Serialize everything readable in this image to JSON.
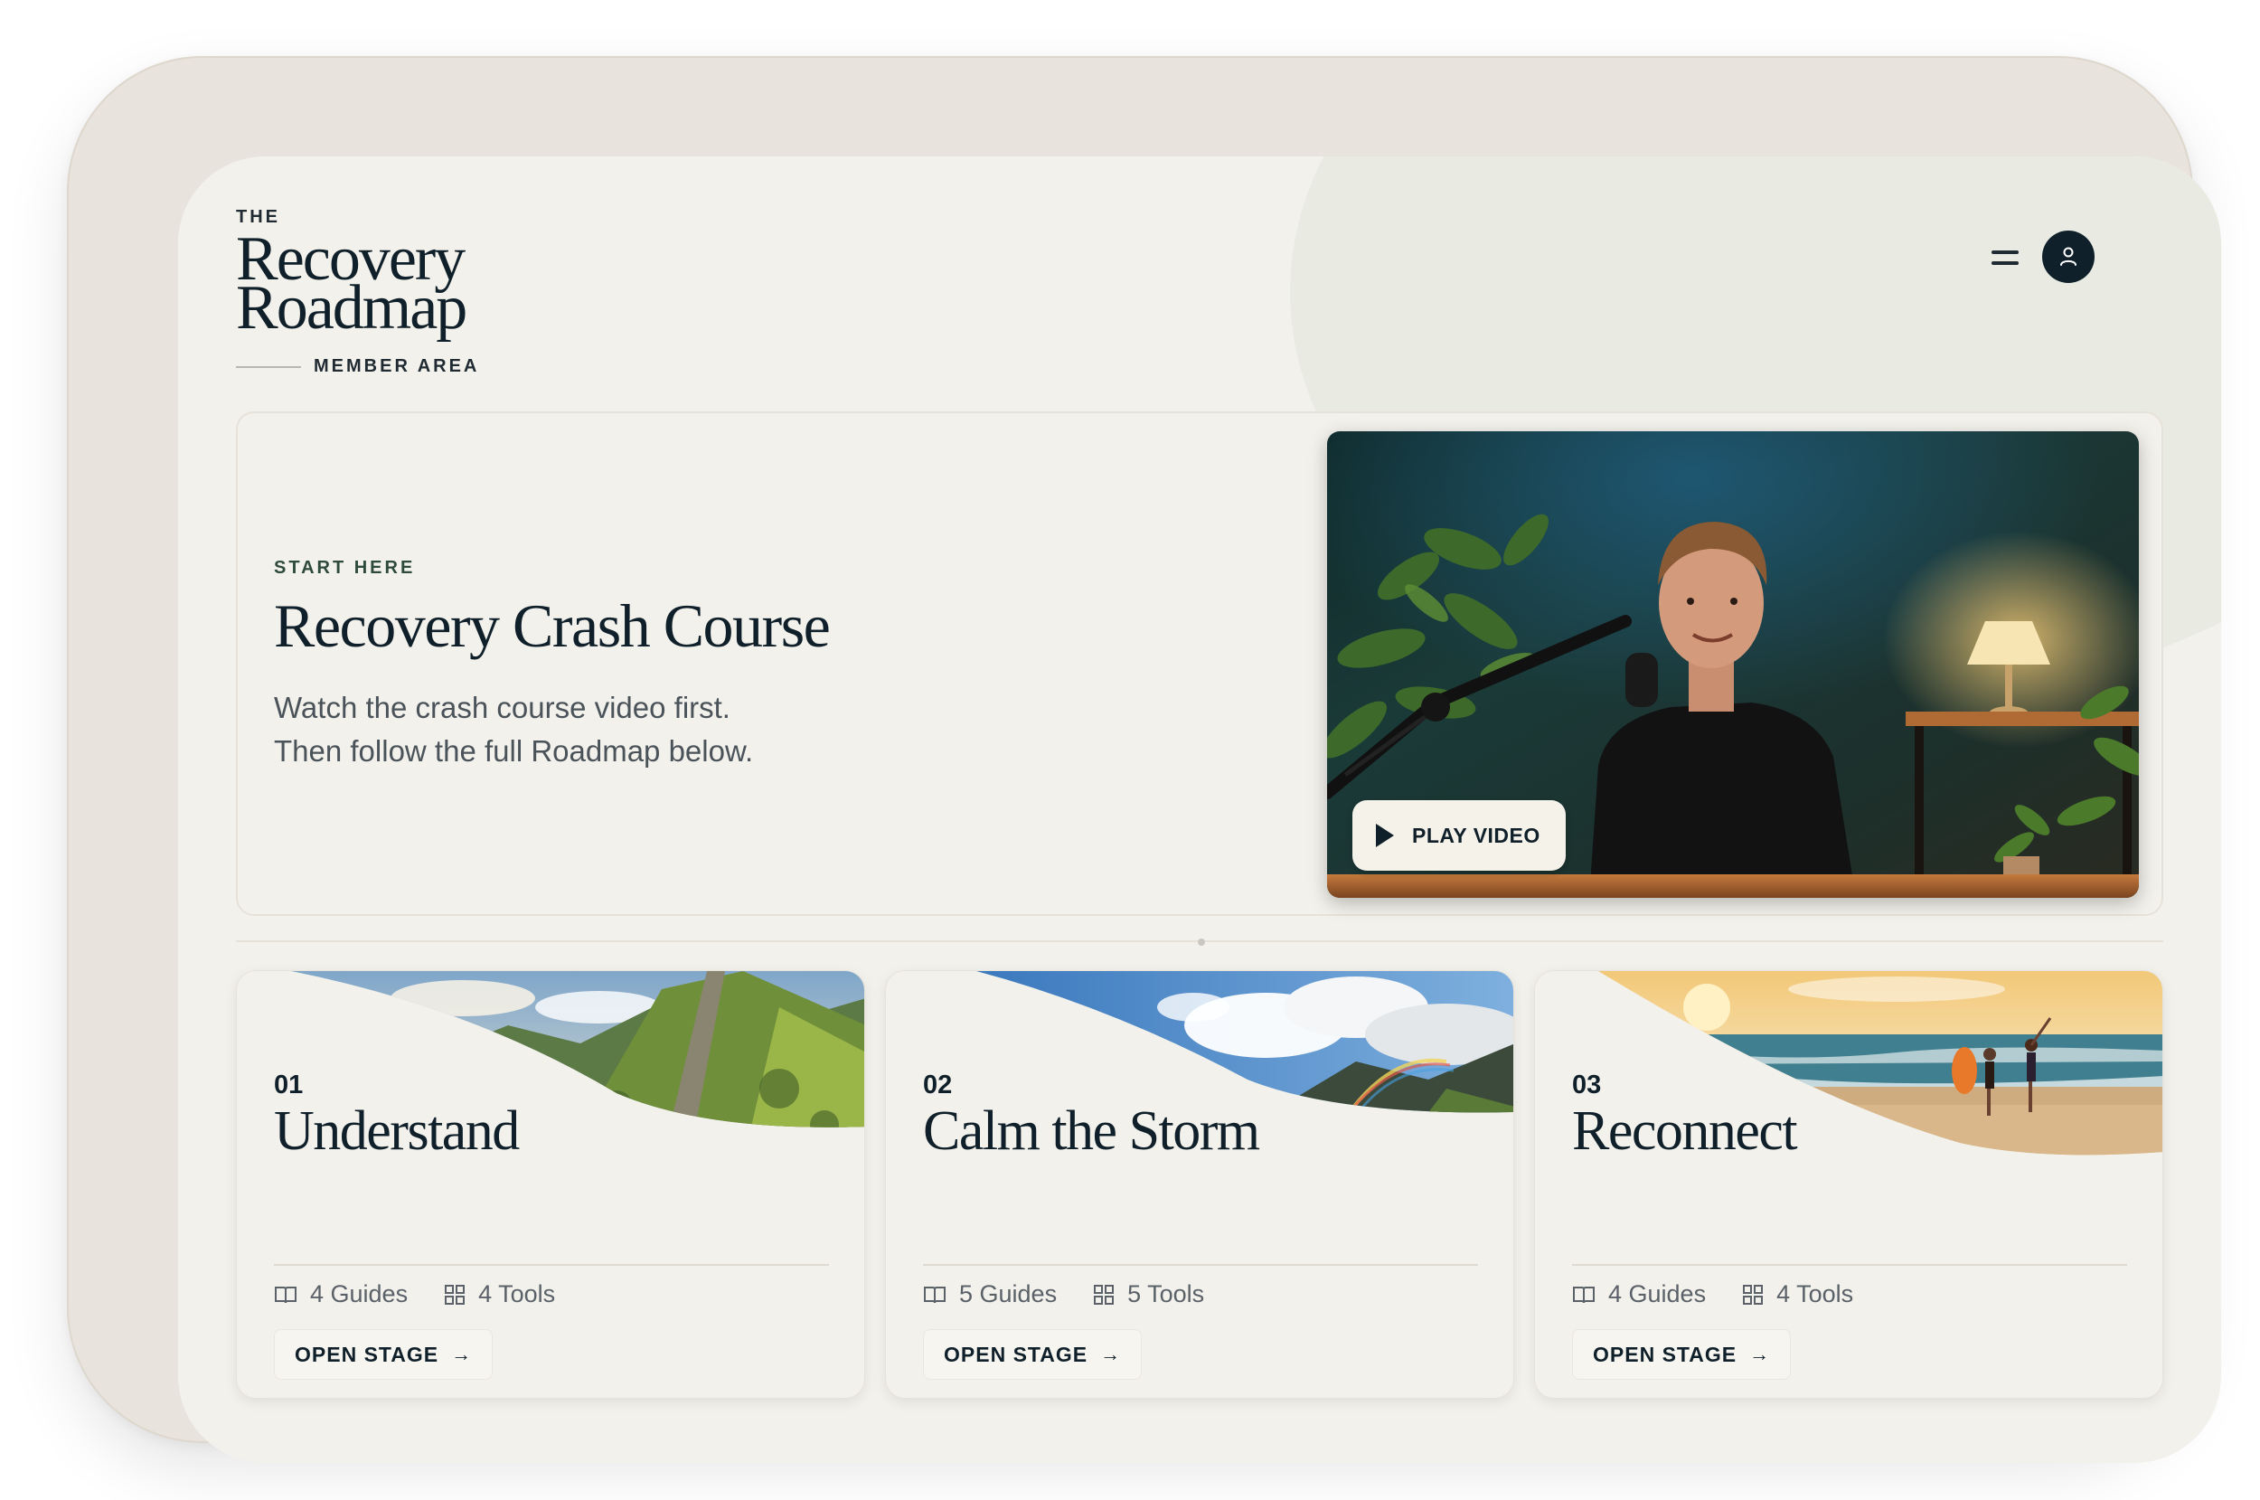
{
  "brand": {
    "the": "THE",
    "line1": "Recovery",
    "line2": "Roadmap",
    "member_area": "MEMBER AREA"
  },
  "header": {
    "menu_icon": "hamburger-menu-icon",
    "avatar_icon": "user-icon"
  },
  "hero": {
    "eyebrow": "START HERE",
    "title": "Recovery Crash Course",
    "desc_line1": "Watch the crash course video first.",
    "desc_line2": "Then follow the full Roadmap below.",
    "play_label": "PLAY VIDEO"
  },
  "stages": [
    {
      "num": "01",
      "title": "Understand",
      "guides": "4 Guides",
      "tools": "4 Tools",
      "button": "OPEN STAGE",
      "art": "mountain-stairs"
    },
    {
      "num": "02",
      "title": "Calm the Storm",
      "guides": "5 Guides",
      "tools": "5 Tools",
      "button": "OPEN STAGE",
      "art": "cloudy-mountain-rainbow"
    },
    {
      "num": "03",
      "title": "Reconnect",
      "guides": "4 Guides",
      "tools": "4 Tools",
      "button": "OPEN STAGE",
      "art": "beach-sunset"
    }
  ],
  "colors": {
    "ink": "#10202b",
    "background": "#f3f1eb",
    "frame": "#e8e3dc",
    "accent_green": "#2e4a3d"
  }
}
